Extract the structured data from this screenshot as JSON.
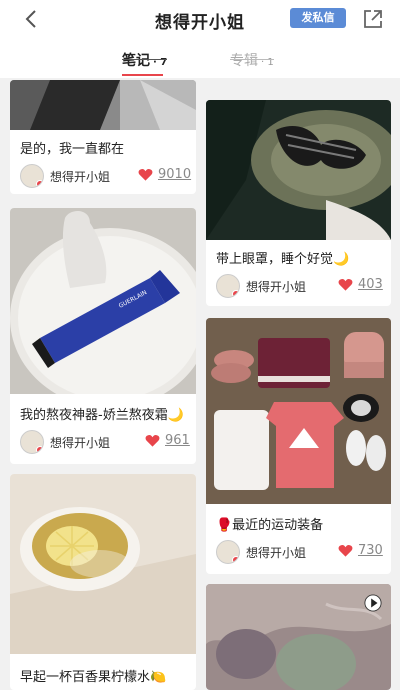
{
  "header": {
    "title": "想得开小姐",
    "dm_label": "发私信"
  },
  "tabs": [
    {
      "label": "笔记",
      "count": "· 7",
      "active": true
    },
    {
      "label": "专辑",
      "count": "· 1",
      "active": false
    }
  ],
  "notes": [
    {
      "caption": "是的，我一直都在",
      "author": "想得开小姐",
      "likes": "9010"
    },
    {
      "caption": "带上眼罩，睡个好觉🌙",
      "author": "想得开小姐",
      "likes": "403"
    },
    {
      "caption": "我的熬夜神器-娇兰熬夜霜🌙",
      "author": "想得开小姐",
      "likes": "961"
    },
    {
      "caption": "🥊最近的运动装备",
      "author": "想得开小姐",
      "likes": "730"
    },
    {
      "caption": "早起一杯百香果柠檬水🍋",
      "author": "",
      "likes": ""
    }
  ],
  "colors": {
    "accent_red": "#e8454b",
    "dm_blue": "#5b8bd6",
    "background": "#f1f1f1"
  },
  "icons": [
    "back-icon",
    "share-icon",
    "heart-icon",
    "play-icon"
  ]
}
